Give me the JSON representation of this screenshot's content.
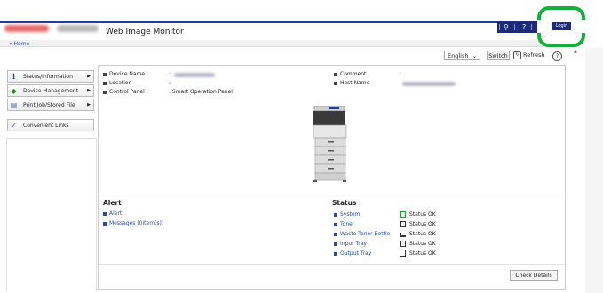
{
  "app_title": "Web Image Monitor",
  "breadcrumb": "« Home",
  "topbar": {
    "search_icon": "magnifier-icon",
    "help_label": "?"
  },
  "login": {
    "label": "Login"
  },
  "toolbar": {
    "language": "English",
    "switch": "Switch",
    "refresh": "Refresh",
    "help": "?"
  },
  "sidebar": {
    "items": [
      {
        "label": "Status/Information",
        "icon": "info-icon"
      },
      {
        "label": "Device Management",
        "icon": "device-management-icon"
      },
      {
        "label": "Print Job/Stored File",
        "icon": "document-icon"
      },
      {
        "label": "Convenient Links",
        "icon": "link-icon"
      }
    ]
  },
  "device_info": {
    "labels": [
      "Device Name",
      "Location",
      "Control Panel"
    ],
    "control_panel_value": ": Smart Operation Panel",
    "colon": ":",
    "right_labels": [
      "Comment",
      "Host Name"
    ]
  },
  "alert": {
    "title": "Alert",
    "items": [
      "Alert",
      "Messages (0item(s))"
    ]
  },
  "status": {
    "title": "Status",
    "items": [
      {
        "name": "System",
        "value": "Status OK",
        "icon": "system-icon"
      },
      {
        "name": "Toner",
        "value": "Status OK",
        "icon": "toner-icon"
      },
      {
        "name": "Waste Toner Bottle",
        "value": "Status OK",
        "icon": "waste-toner-icon"
      },
      {
        "name": "Input Tray",
        "value": "Status OK",
        "icon": "input-tray-icon"
      },
      {
        "name": "Output Tray",
        "value": "Status OK",
        "icon": "output-tray-icon"
      }
    ]
  },
  "check_details": "Check Details",
  "colors": {
    "accent": "#1c2b7a",
    "link": "#2a4aa8",
    "highlight": "#13b13b"
  }
}
